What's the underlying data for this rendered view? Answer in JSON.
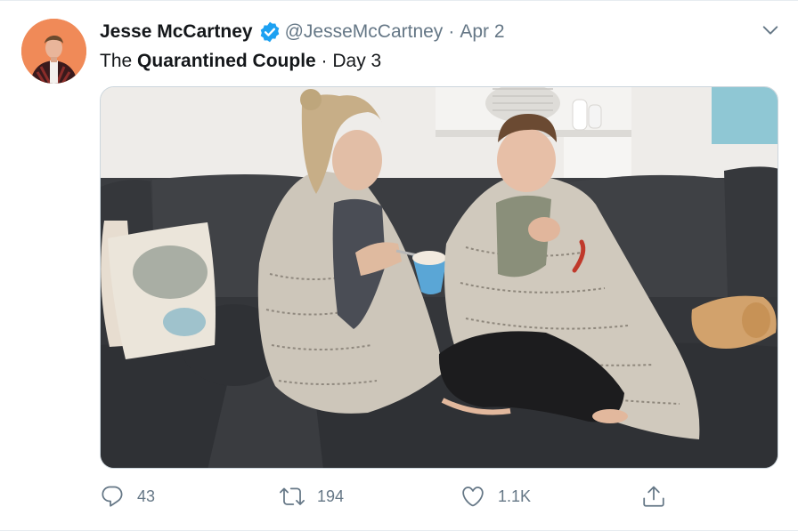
{
  "tweet": {
    "display_name": "Jesse McCartney",
    "handle": "@JesseMcCartney",
    "separator": "·",
    "date": "Apr 2",
    "text_pre": "The ",
    "text_bold": "Quarantined Couple",
    "text_post": " · Day 3",
    "icons": {
      "verified": "verified-badge-icon",
      "caret": "chevron-down-icon",
      "reply": "reply-icon",
      "retweet": "retweet-icon",
      "like": "heart-icon",
      "share": "share-icon"
    },
    "colors": {
      "verified": "#1da1f2",
      "muted": "#657786",
      "text": "#14171a"
    }
  },
  "actions": {
    "reply_count": "43",
    "retweet_count": "194",
    "like_count": "1.1K"
  }
}
